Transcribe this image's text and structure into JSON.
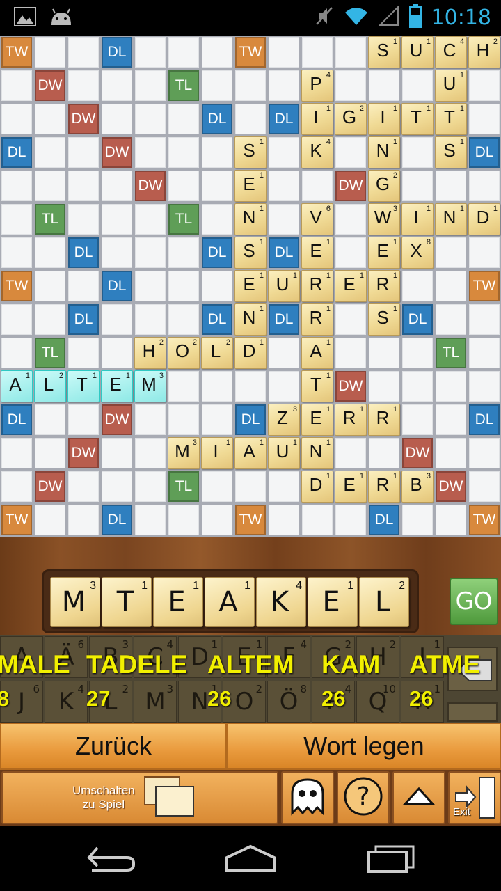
{
  "status_bar": {
    "time": "10:18",
    "icons": [
      "image-icon",
      "android-icon",
      "mute-icon",
      "wifi-icon",
      "signal-icon",
      "battery-icon"
    ]
  },
  "board": {
    "premium_squares": [
      {
        "r": 0,
        "c": 0,
        "t": "TW"
      },
      {
        "r": 0,
        "c": 3,
        "t": "DL"
      },
      {
        "r": 0,
        "c": 7,
        "t": "TW"
      },
      {
        "r": 1,
        "c": 1,
        "t": "DW"
      },
      {
        "r": 1,
        "c": 5,
        "t": "TL"
      },
      {
        "r": 2,
        "c": 2,
        "t": "DW"
      },
      {
        "r": 2,
        "c": 6,
        "t": "DL"
      },
      {
        "r": 2,
        "c": 8,
        "t": "DL"
      },
      {
        "r": 3,
        "c": 0,
        "t": "DL"
      },
      {
        "r": 3,
        "c": 3,
        "t": "DW"
      },
      {
        "r": 3,
        "c": 14,
        "t": "DL"
      },
      {
        "r": 4,
        "c": 4,
        "t": "DW"
      },
      {
        "r": 4,
        "c": 10,
        "t": "DW"
      },
      {
        "r": 5,
        "c": 1,
        "t": "TL"
      },
      {
        "r": 5,
        "c": 5,
        "t": "TL"
      },
      {
        "r": 6,
        "c": 2,
        "t": "DL"
      },
      {
        "r": 6,
        "c": 6,
        "t": "DL"
      },
      {
        "r": 6,
        "c": 8,
        "t": "DL"
      },
      {
        "r": 7,
        "c": 0,
        "t": "TW"
      },
      {
        "r": 7,
        "c": 3,
        "t": "DL"
      },
      {
        "r": 7,
        "c": 14,
        "t": "TW"
      },
      {
        "r": 8,
        "c": 2,
        "t": "DL"
      },
      {
        "r": 8,
        "c": 6,
        "t": "DL"
      },
      {
        "r": 8,
        "c": 8,
        "t": "DL"
      },
      {
        "r": 8,
        "c": 12,
        "t": "DL"
      },
      {
        "r": 9,
        "c": 1,
        "t": "TL"
      },
      {
        "r": 9,
        "c": 13,
        "t": "TL"
      },
      {
        "r": 10,
        "c": 10,
        "t": "DW"
      },
      {
        "r": 11,
        "c": 0,
        "t": "DL"
      },
      {
        "r": 11,
        "c": 3,
        "t": "DW"
      },
      {
        "r": 11,
        "c": 7,
        "t": "DL"
      },
      {
        "r": 11,
        "c": 14,
        "t": "DL"
      },
      {
        "r": 12,
        "c": 2,
        "t": "DW"
      },
      {
        "r": 12,
        "c": 12,
        "t": "DW"
      },
      {
        "r": 13,
        "c": 1,
        "t": "DW"
      },
      {
        "r": 13,
        "c": 5,
        "t": "TL"
      },
      {
        "r": 13,
        "c": 13,
        "t": "DW"
      },
      {
        "r": 14,
        "c": 0,
        "t": "TW"
      },
      {
        "r": 14,
        "c": 3,
        "t": "DL"
      },
      {
        "r": 14,
        "c": 7,
        "t": "TW"
      },
      {
        "r": 14,
        "c": 11,
        "t": "DL"
      },
      {
        "r": 14,
        "c": 14,
        "t": "TW"
      }
    ],
    "tiles": [
      {
        "r": 0,
        "c": 11,
        "l": "S",
        "s": "1"
      },
      {
        "r": 0,
        "c": 12,
        "l": "U",
        "s": "1"
      },
      {
        "r": 0,
        "c": 13,
        "l": "C",
        "s": "4"
      },
      {
        "r": 0,
        "c": 14,
        "l": "H",
        "s": "2"
      },
      {
        "r": 1,
        "c": 9,
        "l": "P",
        "s": "4"
      },
      {
        "r": 1,
        "c": 13,
        "l": "U",
        "s": "1"
      },
      {
        "r": 2,
        "c": 9,
        "l": "I",
        "s": "1"
      },
      {
        "r": 2,
        "c": 10,
        "l": "G",
        "s": "2"
      },
      {
        "r": 2,
        "c": 11,
        "l": "I",
        "s": "1"
      },
      {
        "r": 2,
        "c": 12,
        "l": "T",
        "s": "1"
      },
      {
        "r": 2,
        "c": 13,
        "l": "T",
        "s": "1"
      },
      {
        "r": 3,
        "c": 7,
        "l": "S",
        "s": "1"
      },
      {
        "r": 3,
        "c": 9,
        "l": "K",
        "s": "4"
      },
      {
        "r": 3,
        "c": 11,
        "l": "N",
        "s": "1"
      },
      {
        "r": 3,
        "c": 13,
        "l": "S",
        "s": "1"
      },
      {
        "r": 4,
        "c": 7,
        "l": "E",
        "s": "1"
      },
      {
        "r": 4,
        "c": 11,
        "l": "G",
        "s": "2"
      },
      {
        "r": 5,
        "c": 7,
        "l": "N",
        "s": "1"
      },
      {
        "r": 5,
        "c": 9,
        "l": "V",
        "s": "6"
      },
      {
        "r": 5,
        "c": 11,
        "l": "W",
        "s": "3"
      },
      {
        "r": 5,
        "c": 12,
        "l": "I",
        "s": "1"
      },
      {
        "r": 5,
        "c": 13,
        "l": "N",
        "s": "1"
      },
      {
        "r": 5,
        "c": 14,
        "l": "D",
        "s": "1"
      },
      {
        "r": 6,
        "c": 7,
        "l": "S",
        "s": "1"
      },
      {
        "r": 6,
        "c": 9,
        "l": "E",
        "s": "1"
      },
      {
        "r": 6,
        "c": 11,
        "l": "E",
        "s": "1"
      },
      {
        "r": 6,
        "c": 12,
        "l": "X",
        "s": "8"
      },
      {
        "r": 7,
        "c": 7,
        "l": "E",
        "s": "1"
      },
      {
        "r": 7,
        "c": 8,
        "l": "U",
        "s": "1"
      },
      {
        "r": 7,
        "c": 9,
        "l": "R",
        "s": "1"
      },
      {
        "r": 7,
        "c": 10,
        "l": "E",
        "s": "1"
      },
      {
        "r": 7,
        "c": 11,
        "l": "R",
        "s": "1"
      },
      {
        "r": 8,
        "c": 7,
        "l": "N",
        "s": "1"
      },
      {
        "r": 8,
        "c": 9,
        "l": "R",
        "s": "1"
      },
      {
        "r": 8,
        "c": 11,
        "l": "S",
        "s": "1"
      },
      {
        "r": 9,
        "c": 4,
        "l": "H",
        "s": "2"
      },
      {
        "r": 9,
        "c": 5,
        "l": "O",
        "s": "2"
      },
      {
        "r": 9,
        "c": 6,
        "l": "L",
        "s": "2"
      },
      {
        "r": 9,
        "c": 7,
        "l": "D",
        "s": "1"
      },
      {
        "r": 9,
        "c": 9,
        "l": "A",
        "s": "1"
      },
      {
        "r": 10,
        "c": 0,
        "l": "A",
        "s": "1",
        "hl": true
      },
      {
        "r": 10,
        "c": 1,
        "l": "L",
        "s": "2",
        "hl": true
      },
      {
        "r": 10,
        "c": 2,
        "l": "T",
        "s": "1",
        "hl": true
      },
      {
        "r": 10,
        "c": 3,
        "l": "E",
        "s": "1",
        "hl": true
      },
      {
        "r": 10,
        "c": 4,
        "l": "M",
        "s": "3",
        "hl": true
      },
      {
        "r": 10,
        "c": 9,
        "l": "T",
        "s": "1"
      },
      {
        "r": 11,
        "c": 8,
        "l": "Z",
        "s": "3"
      },
      {
        "r": 11,
        "c": 9,
        "l": "E",
        "s": "1"
      },
      {
        "r": 11,
        "c": 10,
        "l": "R",
        "s": "1"
      },
      {
        "r": 11,
        "c": 11,
        "l": "R",
        "s": "1"
      },
      {
        "r": 12,
        "c": 5,
        "l": "M",
        "s": "3"
      },
      {
        "r": 12,
        "c": 6,
        "l": "I",
        "s": "1"
      },
      {
        "r": 12,
        "c": 7,
        "l": "A",
        "s": "1"
      },
      {
        "r": 12,
        "c": 8,
        "l": "U",
        "s": "1"
      },
      {
        "r": 12,
        "c": 9,
        "l": "N",
        "s": "1"
      },
      {
        "r": 13,
        "c": 9,
        "l": "D",
        "s": "1"
      },
      {
        "r": 13,
        "c": 10,
        "l": "E",
        "s": "1"
      },
      {
        "r": 13,
        "c": 11,
        "l": "R",
        "s": "1"
      },
      {
        "r": 13,
        "c": 12,
        "l": "B",
        "s": "3"
      }
    ]
  },
  "rack": {
    "tiles": [
      {
        "l": "M",
        "s": "3"
      },
      {
        "l": "T",
        "s": "1"
      },
      {
        "l": "E",
        "s": "1"
      },
      {
        "l": "A",
        "s": "1"
      },
      {
        "l": "K",
        "s": "4"
      },
      {
        "l": "E",
        "s": "1"
      },
      {
        "l": "L",
        "s": "2"
      }
    ],
    "go_label": "GO"
  },
  "keyboard": {
    "row1": [
      {
        "l": "A",
        "s": ""
      },
      {
        "l": "Ä",
        "s": "6"
      },
      {
        "l": "B",
        "s": "3"
      },
      {
        "l": "C",
        "s": "4"
      },
      {
        "l": "D",
        "s": "1"
      },
      {
        "l": "E",
        "s": "1"
      },
      {
        "l": "F",
        "s": "4"
      },
      {
        "l": "G",
        "s": "2"
      },
      {
        "l": "H",
        "s": "2"
      },
      {
        "l": "I",
        "s": "1"
      }
    ],
    "row2": [
      {
        "l": "J",
        "s": "6"
      },
      {
        "l": "K",
        "s": "4"
      },
      {
        "l": "L",
        "s": "2"
      },
      {
        "l": "M",
        "s": "3"
      },
      {
        "l": "N",
        "s": "1"
      },
      {
        "l": "O",
        "s": "2"
      },
      {
        "l": "Ö",
        "s": "8"
      },
      {
        "l": "P",
        "s": "4"
      },
      {
        "l": "Q",
        "s": "10"
      },
      {
        "l": "R",
        "s": "1"
      }
    ]
  },
  "suggestions": [
    {
      "word": "MALE",
      "points": "8"
    },
    {
      "word": "TADELE",
      "points": "27"
    },
    {
      "word": "ALTEM",
      "points": "26"
    },
    {
      "word": "KAM",
      "points": "26"
    },
    {
      "word": "ATME",
      "points": "26"
    }
  ],
  "actions": {
    "back": "Zurück",
    "place_word": "Wort legen"
  },
  "bottom_bar": {
    "switch_line1": "Umschalten",
    "switch_line2": "zu Spiel",
    "exit": "Exit"
  }
}
